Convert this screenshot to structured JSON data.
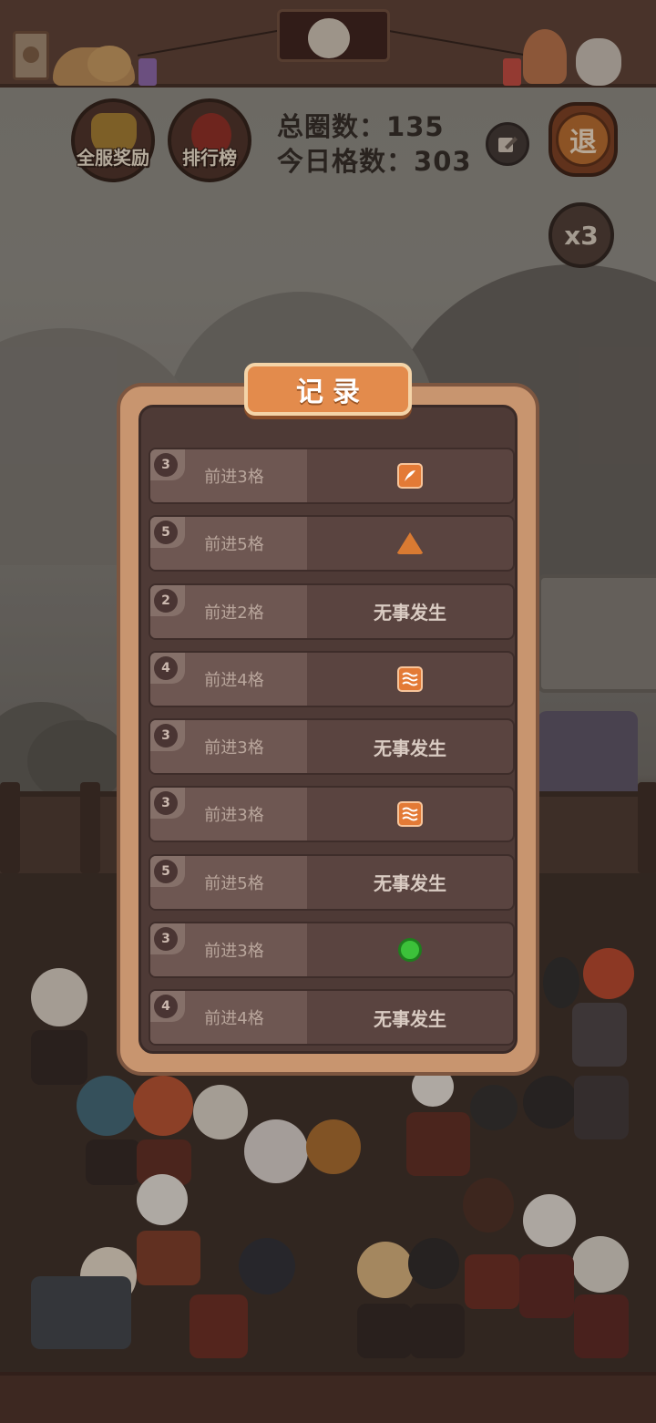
{
  "hud": {
    "server_rewards_label": "全服奖励",
    "leaderboard_label": "排行榜",
    "total_laps_label": "总圈数：",
    "total_laps_value": "135",
    "today_steps_label": "今日格数：",
    "today_steps_value": "303",
    "quit_label": "退",
    "multiplier_label": "x3"
  },
  "record_modal": {
    "title": "记录",
    "rows": [
      {
        "badge": "3",
        "step_text": "前进3格",
        "event_text": "",
        "event_icon": "orange-scroll-icon"
      },
      {
        "badge": "5",
        "step_text": "前进5格",
        "event_text": "",
        "event_icon": "rice-dumpling-icon"
      },
      {
        "badge": "2",
        "step_text": "前进2格",
        "event_text": "无事发生",
        "event_icon": ""
      },
      {
        "badge": "4",
        "step_text": "前进4格",
        "event_text": "",
        "event_icon": "orange-wave-icon"
      },
      {
        "badge": "3",
        "step_text": "前进3格",
        "event_text": "无事发生",
        "event_icon": ""
      },
      {
        "badge": "3",
        "step_text": "前进3格",
        "event_text": "",
        "event_icon": "orange-wave-icon"
      },
      {
        "badge": "5",
        "step_text": "前进5格",
        "event_text": "无事发生",
        "event_icon": ""
      },
      {
        "badge": "3",
        "step_text": "前进3格",
        "event_text": "",
        "event_icon": "green-orb-icon"
      },
      {
        "badge": "4",
        "step_text": "前进4格",
        "event_text": "无事发生",
        "event_icon": ""
      }
    ]
  },
  "colors": {
    "modal_frame": "#c8956f",
    "modal_title_bg": "#e38b4c",
    "row_left_bg": "#6e5752",
    "row_right_bg": "#5a4440"
  }
}
